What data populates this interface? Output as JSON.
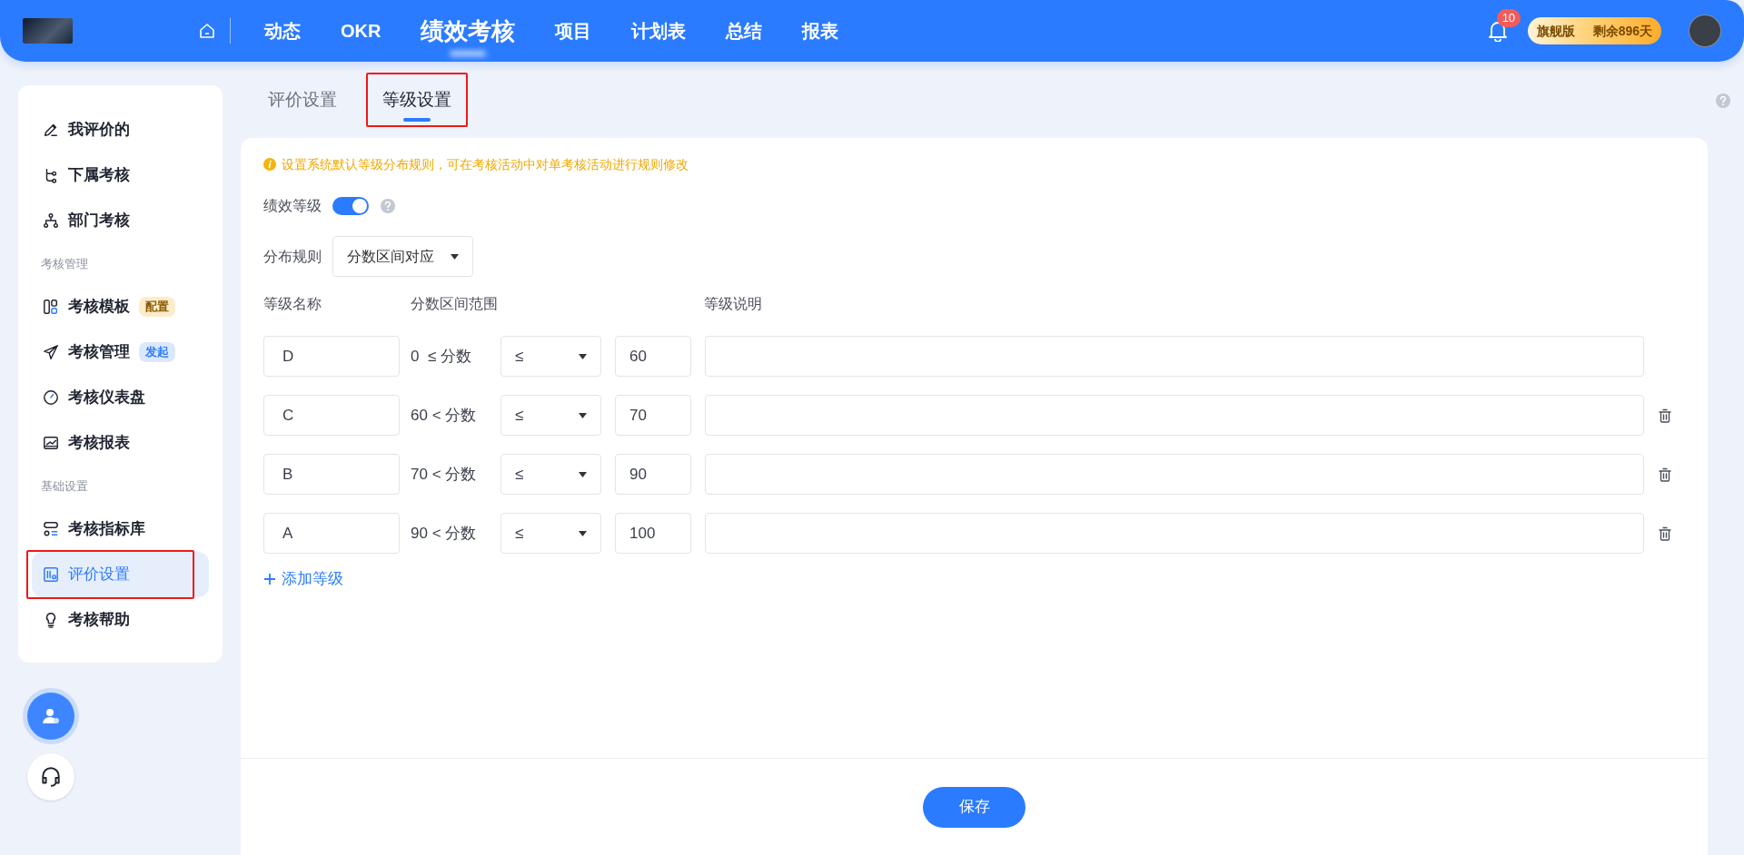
{
  "top_nav": {
    "items": [
      {
        "label": "动态",
        "selected": false
      },
      {
        "label": "OKR",
        "selected": false
      },
      {
        "label": "绩效考核",
        "selected": true
      },
      {
        "label": "项目",
        "selected": false
      },
      {
        "label": "计划表",
        "selected": false
      },
      {
        "label": "总结",
        "selected": false
      },
      {
        "label": "报表",
        "selected": false
      }
    ],
    "notification_count": "10",
    "plan": {
      "name": "旗舰版",
      "remaining": "剩余896天"
    }
  },
  "sidebar": {
    "items": [
      {
        "kind": "item",
        "label": "我评价的",
        "selected": false,
        "annotated": false
      },
      {
        "kind": "item",
        "label": "下属考核",
        "selected": false,
        "annotated": false
      },
      {
        "kind": "item",
        "label": "部门考核",
        "selected": false,
        "annotated": false
      },
      {
        "kind": "section",
        "label": "考核管理"
      },
      {
        "kind": "item",
        "label": "考核模板",
        "selected": false,
        "annotated": false,
        "badge": {
          "text": "配置",
          "color": "#fdeccc"
        }
      },
      {
        "kind": "item",
        "label": "考核管理",
        "selected": false,
        "annotated": false,
        "badge": {
          "text": "发起",
          "color": "#dbe8fd"
        }
      },
      {
        "kind": "item",
        "label": "考核仪表盘",
        "selected": false,
        "annotated": false
      },
      {
        "kind": "item",
        "label": "考核报表",
        "selected": false,
        "annotated": false
      },
      {
        "kind": "section",
        "label": "基础设置"
      },
      {
        "kind": "item",
        "label": "考核指标库",
        "selected": false,
        "annotated": false
      },
      {
        "kind": "item",
        "label": "评价设置",
        "selected": true,
        "annotated": true
      },
      {
        "kind": "item",
        "label": "考核帮助",
        "selected": false,
        "annotated": false
      }
    ]
  },
  "tabs": [
    {
      "label": "评价设置",
      "selected": false,
      "annotated": false
    },
    {
      "label": "等级设置",
      "selected": true,
      "annotated": true
    }
  ],
  "notice": "设置系统默认等级分布规则，可在考核活动中对单考核活动进行规则修改",
  "grade_toggle": {
    "label": "绩效等级",
    "on": true
  },
  "distribution_rule": {
    "label": "分布规则",
    "value": "分数区间对应"
  },
  "table": {
    "columns": [
      "等级名称",
      "分数区间范围",
      "等级说明"
    ],
    "rows": [
      {
        "name": "D",
        "range": "0  ≤ 分数",
        "operator": "≤",
        "upper": "60",
        "deletable": false
      },
      {
        "name": "C",
        "range": "60 < 分数",
        "operator": "≤",
        "upper": "70",
        "deletable": true
      },
      {
        "name": "B",
        "range": "70 < 分数",
        "operator": "≤",
        "upper": "90",
        "deletable": true
      },
      {
        "name": "A",
        "range": "90 < 分数",
        "operator": "≤",
        "upper": "100",
        "deletable": true
      }
    ]
  },
  "add_button": "添加等级",
  "save_button": "保存"
}
